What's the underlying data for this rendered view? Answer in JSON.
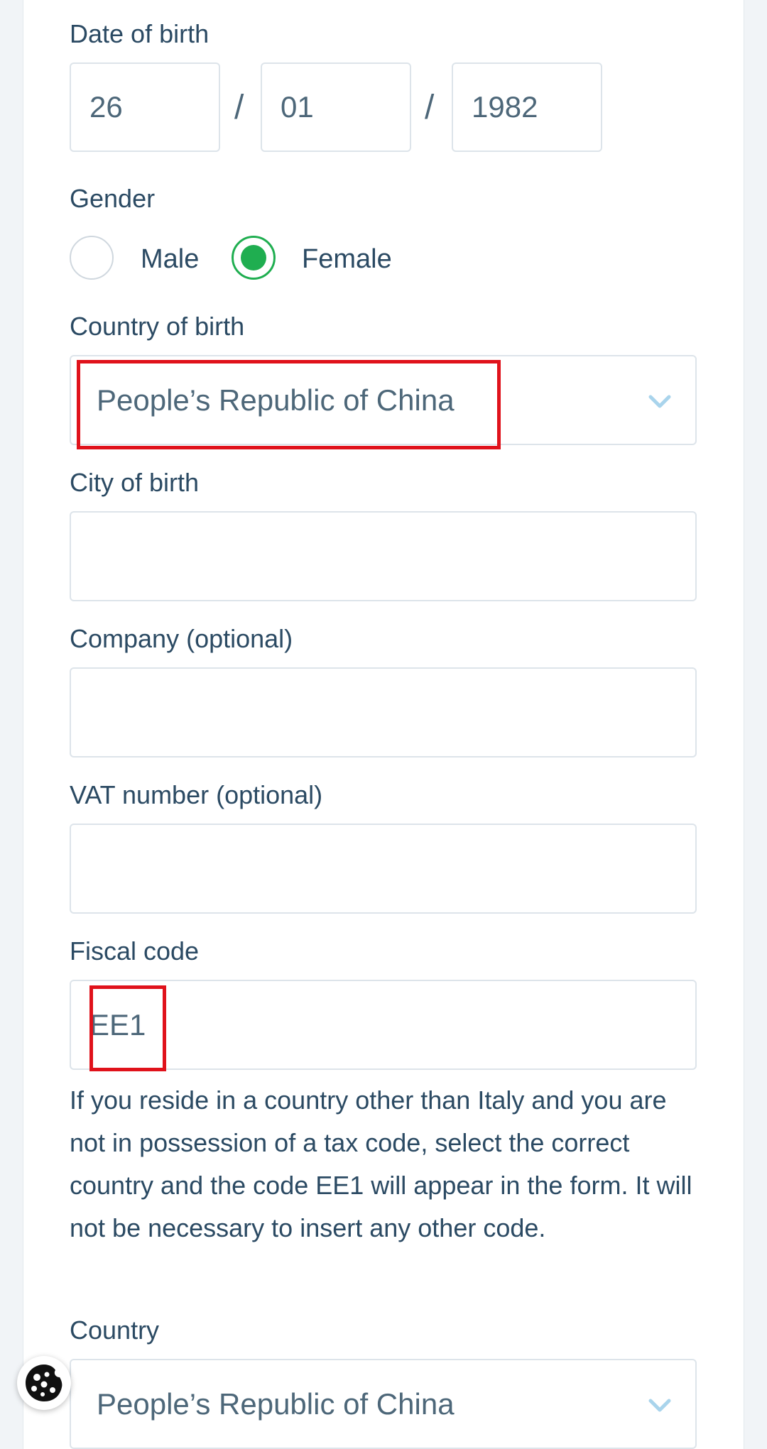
{
  "dob": {
    "label": "Date of birth",
    "day": "26",
    "month": "01",
    "year": "1982",
    "separator": "/"
  },
  "gender": {
    "label": "Gender",
    "options": [
      {
        "label": "Male",
        "checked": false
      },
      {
        "label": "Female",
        "checked": true
      }
    ]
  },
  "country_of_birth": {
    "label": "Country of birth",
    "value": "People’s Republic of China"
  },
  "city_of_birth": {
    "label": "City of birth",
    "value": ""
  },
  "company": {
    "label": "Company (optional)",
    "value": ""
  },
  "vat": {
    "label": "VAT number (optional)",
    "value": ""
  },
  "fiscal_code": {
    "label": "Fiscal code",
    "value": "EE1",
    "help": "If you reside in a country other than Italy and you are not in possession of a tax code, select the correct country and the code EE1 will appear in the form. It will not be necessary to insert any other code."
  },
  "country": {
    "label": "Country",
    "value": "People’s Republic of China"
  },
  "colors": {
    "text": "#2b4a63",
    "accent_green": "#1fae50",
    "chevron": "#a9d4ec",
    "highlight_red": "#e0121b"
  },
  "icons": {
    "select_arrow": "chevron-down-icon",
    "cookie": "cookie-icon"
  }
}
